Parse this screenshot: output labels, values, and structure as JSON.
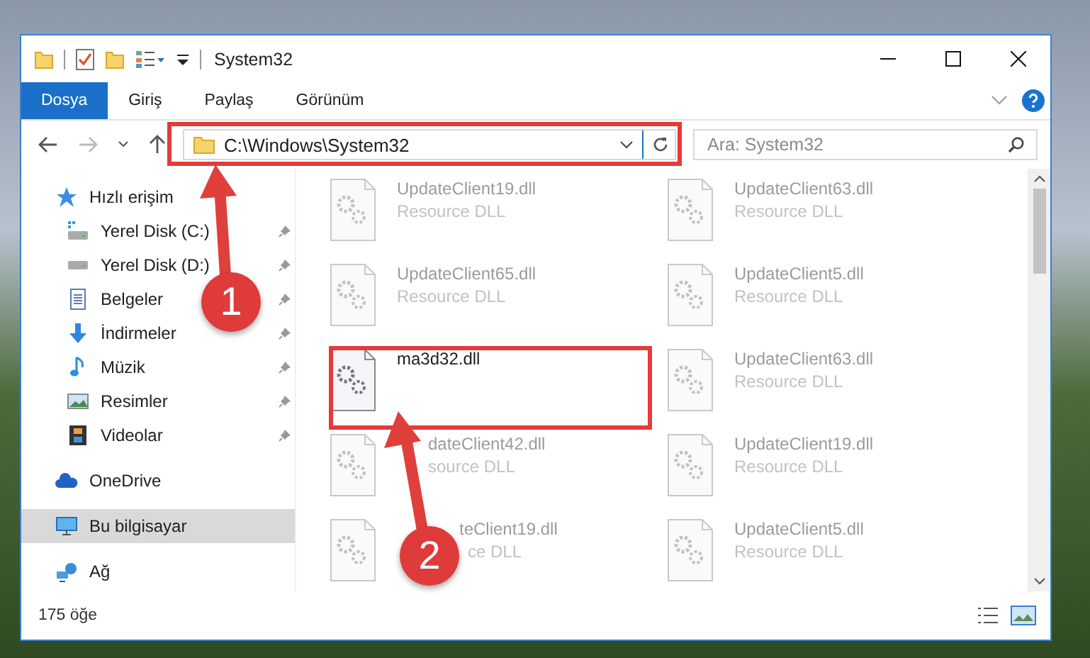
{
  "window": {
    "title": "System32"
  },
  "ribbon_tabs": [
    {
      "label": "Dosya",
      "selected": true
    },
    {
      "label": "Giriş",
      "selected": false
    },
    {
      "label": "Paylaş",
      "selected": false
    },
    {
      "label": "Görünüm",
      "selected": false
    }
  ],
  "address_bar": {
    "path": "C:\\Windows\\System32"
  },
  "search": {
    "placeholder": "Ara: System32"
  },
  "sidebar": {
    "items": [
      {
        "label": "Hızlı erişim",
        "kind": "star",
        "pinned": false,
        "selected": false,
        "children": [
          {
            "label": "Yerel Disk (C:)",
            "kind": "system-drive",
            "pinned": true,
            "selected": false
          },
          {
            "label": "Yerel Disk (D:)",
            "kind": "drive",
            "pinned": true,
            "selected": false
          },
          {
            "label": "Belgeler",
            "kind": "document",
            "pinned": true,
            "selected": false
          },
          {
            "label": "İndirmeler",
            "kind": "download",
            "pinned": true,
            "selected": false
          },
          {
            "label": "Müzik",
            "kind": "music",
            "pinned": true,
            "selected": false
          },
          {
            "label": "Resimler",
            "kind": "picture",
            "pinned": true,
            "selected": false
          },
          {
            "label": "Videolar",
            "kind": "video",
            "pinned": true,
            "selected": false
          }
        ]
      },
      {
        "label": "OneDrive",
        "kind": "cloud",
        "pinned": false,
        "selected": false
      },
      {
        "label": "Bu bilgisayar",
        "kind": "computer",
        "pinned": false,
        "selected": true
      },
      {
        "label": "Ağ",
        "kind": "network",
        "pinned": false,
        "selected": false
      }
    ]
  },
  "files": [
    {
      "name": "UpdateClient19.dll",
      "type": "Resource DLL",
      "blurred": true
    },
    {
      "name": "UpdateClient63.dll",
      "type": "Resource DLL",
      "blurred": true
    },
    {
      "name": "UpdateClient65.dll",
      "type": "Resource DLL",
      "blurred": true
    },
    {
      "name": "UpdateClient5.dll",
      "type": "Resource DLL",
      "blurred": true
    },
    {
      "name": "ma3d32.dll",
      "blurred": false
    },
    {
      "name": "UpdateClient63.dll",
      "type": "Resource DLL",
      "blurred": true
    },
    {
      "name": "dateClient42.dll",
      "type": "source DLL",
      "blurred": true
    },
    {
      "name": "UpdateClient19.dll",
      "type": "Resource DLL",
      "blurred": true
    },
    {
      "name": "teClient19.dll",
      "type": "ce DLL",
      "blurred": true
    },
    {
      "name": "UpdateClient5.dll",
      "type": "Resource DLL",
      "blurred": true
    }
  ],
  "status_bar": {
    "item_count": "175 öğe"
  },
  "annotations": {
    "markers": [
      {
        "label": "1"
      },
      {
        "label": "2"
      }
    ]
  }
}
